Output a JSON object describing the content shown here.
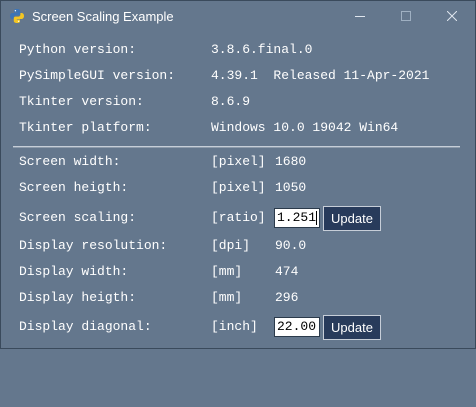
{
  "window": {
    "title": "Screen Scaling Example",
    "app_icon": "python-logo-icon",
    "controls": [
      "minimize-icon",
      "maximize-icon",
      "close-icon"
    ]
  },
  "info": [
    {
      "label": "Python version:",
      "value": "3.8.6.final.0"
    },
    {
      "label": "PySimpleGUI version:",
      "value": "4.39.1  Released 11-Apr-2021"
    },
    {
      "label": "Tkinter version:",
      "value": "8.6.9"
    },
    {
      "label": "Tkinter platform:",
      "value": "Windows 10.0 19042 Win64"
    }
  ],
  "metrics": {
    "screen_width": {
      "label": "Screen width:",
      "unit": "[pixel]",
      "value": "1680"
    },
    "screen_height": {
      "label": "Screen heigth:",
      "unit": "[pixel]",
      "value": "1050"
    },
    "screen_scaling": {
      "label": "Screen scaling:",
      "unit": "[ratio]",
      "value": "1.251",
      "button": "Update"
    },
    "display_resolution": {
      "label": "Display resolution:",
      "unit": "[dpi]",
      "value": "90.0"
    },
    "display_width": {
      "label": "Display width:",
      "unit": "[mm]",
      "value": "474"
    },
    "display_height": {
      "label": "Display heigth:",
      "unit": "[mm]",
      "value": "296"
    },
    "display_diagonal": {
      "label": "Display diagonal:",
      "unit": "[inch]",
      "value": "22.00",
      "button": "Update"
    }
  },
  "colors": {
    "background": "#64778d",
    "button_bg": "#283b5b",
    "text": "#ffffff"
  }
}
